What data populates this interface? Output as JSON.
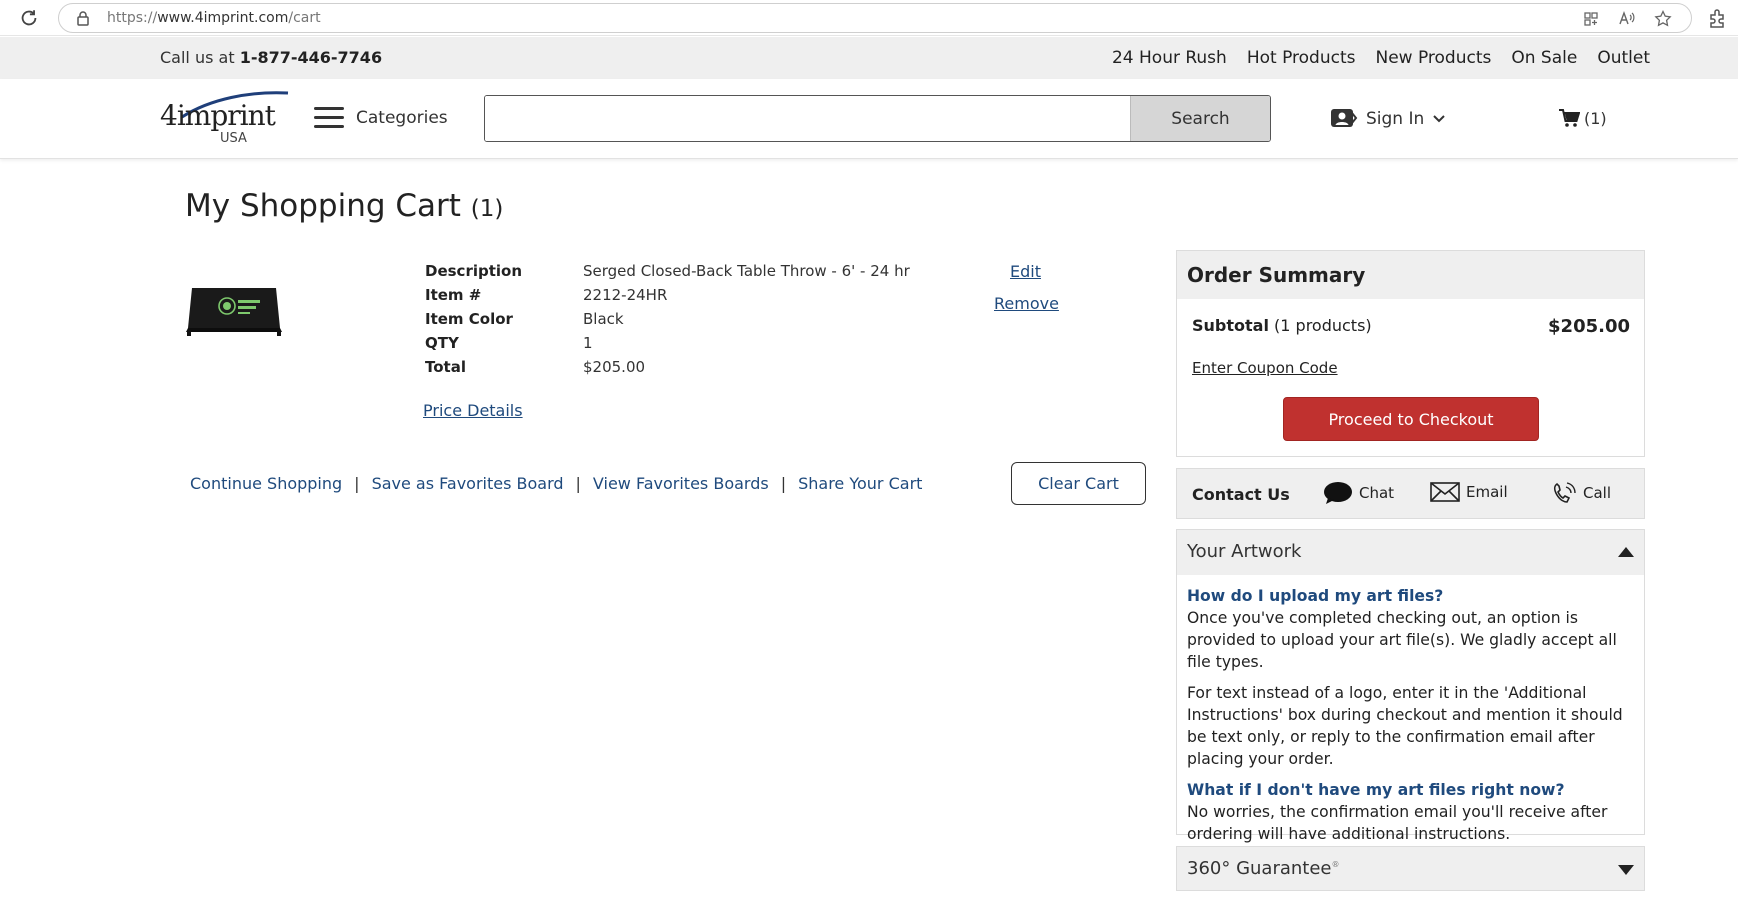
{
  "browser": {
    "url_scheme": "https://",
    "url_host": "www.4imprint.com",
    "url_path": "/cart"
  },
  "utility": {
    "call_prefix": "Call us at",
    "phone": "1-877-446-7746",
    "nav": [
      "24 Hour Rush",
      "Hot Products",
      "New Products",
      "On Sale",
      "Outlet"
    ]
  },
  "header": {
    "logo_word": "4imprint",
    "logo_country": "USA",
    "categories": "Categories",
    "search_value": "",
    "search_button": "Search",
    "sign_in": "Sign In",
    "cart_count": "(1)"
  },
  "cart": {
    "title": "My Shopping Cart",
    "count": "(1)",
    "item": {
      "labels": [
        "Description",
        "Item #",
        "Item Color",
        "QTY",
        "Total"
      ],
      "values": [
        "Serged Closed-Back Table Throw - 6' - 24 hr",
        "2212-24HR",
        "Black",
        "1",
        "$205.00"
      ],
      "price_details": "Price Details",
      "edit": "Edit",
      "remove": "Remove"
    },
    "actions": [
      "Continue Shopping",
      "Save as Favorites Board",
      "View Favorites Boards",
      "Share Your Cart"
    ],
    "separator": "|",
    "clear_cart": "Clear Cart"
  },
  "summary": {
    "title": "Order Summary",
    "subtotal_label": "Subtotal",
    "subtotal_products": "(1 products)",
    "subtotal_value": "$205.00",
    "coupon": "Enter Coupon Code",
    "checkout": "Proceed to Checkout"
  },
  "contact": {
    "label": "Contact Us",
    "chat": "Chat",
    "email": "Email",
    "call": "Call"
  },
  "artwork": {
    "title": "Your Artwork",
    "q1": "How do I upload my art files?",
    "a1": "Once you've completed checking out, an option is provided to upload your art file(s). We gladly accept all file types.",
    "a1b": "For text instead of a logo, enter it in the 'Additional Instructions' box during checkout and mention it should be text only, or reply to the confirmation email after placing your order.",
    "q2": "What if I don't have my art files right now?",
    "a2": "No worries, the confirmation email you'll receive after ordering will have additional instructions."
  },
  "guarantee": {
    "title": "360° Guarantee",
    "mark": "®"
  },
  "colors": {
    "link": "#1f4a7d",
    "checkout": "#c0312f",
    "panel": "#efefef"
  }
}
